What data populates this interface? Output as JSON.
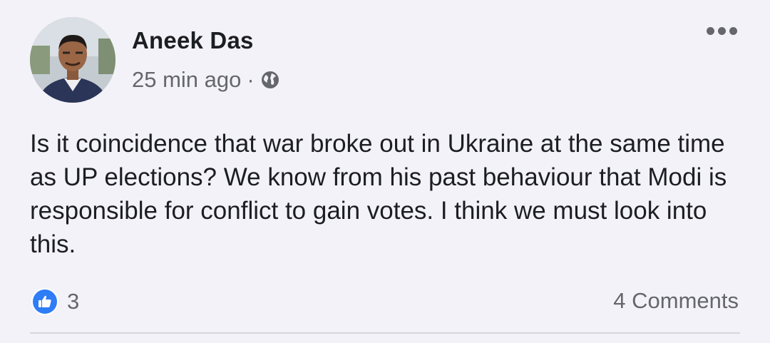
{
  "post": {
    "author": {
      "name": "Aneek Das",
      "avatar_icon": "profile-photo"
    },
    "meta": {
      "time": "25 min ago",
      "separator": "·",
      "audience_icon": "globe-icon"
    },
    "more_icon": "more-horizontal-icon",
    "body_text": "Is it coincidence that war broke out in Ukraine at the same time as UP elections? We know from his past behaviour that Modi is responsible for conflict to gain votes. I think we must look into this.",
    "reactions": {
      "icon": "like-icon",
      "count": "3"
    },
    "comments": "4 Comments"
  },
  "colors": {
    "background": "#f3f2f8",
    "text_primary": "#1c1e21",
    "text_secondary": "#65676b",
    "like_blue": "#2e7cf6",
    "divider": "#d5d6da"
  }
}
